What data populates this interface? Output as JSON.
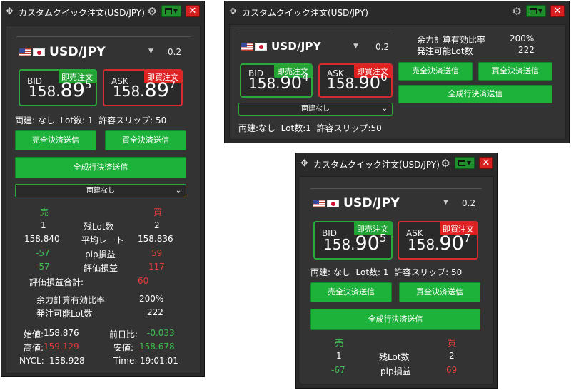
{
  "colors": {
    "bid_green": "#2aa83a",
    "ask_red": "#d82b2b",
    "button_green": "#1db33a",
    "profit_green": "#3fbf4f",
    "loss_red": "#e23b3b"
  },
  "window_title": "カスタムクイック注文(USD/JPY)",
  "icons": {
    "move": "move-arrows-icon",
    "settings": "gear-icon",
    "layout": "layout-icon",
    "close": "close-icon"
  },
  "symbol": "USD/JPY",
  "spread": "0.2",
  "bid_label": "BID",
  "ask_label": "ASK",
  "bid_tag": "即売注文",
  "ask_tag": "即買注文",
  "close_mark": "✕",
  "sell_settle": "売全決済送信",
  "buy_settle": "買全決済送信",
  "all_settle": "全成行決済送信",
  "hedge_select": "両建なし",
  "hedge_info": "両建: なし",
  "lot_info": "Lot数: 1",
  "slip_info": "許容スリップ: 50",
  "win1": {
    "bid_big": "158.",
    "bid_main": "89",
    "bid_sup": "5",
    "ask_big": "158.",
    "ask_main": "89",
    "ask_sup": "7",
    "sell_head": "売",
    "buy_head": "買",
    "rows": [
      {
        "left": "1",
        "label": "残Lot数",
        "right": "2"
      },
      {
        "left": "158.840",
        "label": "平均レート",
        "right": "158.836"
      },
      {
        "left": "-57",
        "label": "pip損益",
        "right": "59"
      },
      {
        "left": "-57",
        "label": "評価損益",
        "right": "117"
      }
    ],
    "total_label": "評価損益合計:",
    "total_value": "60",
    "margin_label": "余力計算有効比率",
    "margin_value": "200%",
    "orderable_label": "発注可能Lot数",
    "orderable_value": "222",
    "open_label": "始値:",
    "open_value": "158.876",
    "change_label": "前日比:",
    "change_value": "-0.033",
    "high_label": "高値:",
    "high_value": "159.129",
    "low_label": "安値:",
    "low_value": "158.678",
    "nycl_label": "NYCL:",
    "nycl_value": "158.928",
    "time_label": "Time:",
    "time_value": "19:01:01"
  },
  "win2": {
    "bid_big": "158.",
    "bid_main": "90",
    "bid_sup": "4",
    "ask_big": "158.",
    "ask_main": "90",
    "ask_sup": "6",
    "margin_label": "余力計算有効比率",
    "margin_value": "200%",
    "orderable_label": "発注可能Lot数",
    "orderable_value": "222",
    "info_line": "両建:なし  Lot数:1  許容スリップ:50"
  },
  "win3": {
    "bid_big": "158.",
    "bid_main": "90",
    "bid_sup": "5",
    "ask_big": "158.",
    "ask_main": "90",
    "ask_sup": "7",
    "sell_head": "売",
    "buy_head": "買",
    "rows": [
      {
        "left": "1",
        "label": "残Lot数",
        "right": "2"
      },
      {
        "left": "-67",
        "label": "pip損益",
        "right": "69"
      }
    ]
  }
}
